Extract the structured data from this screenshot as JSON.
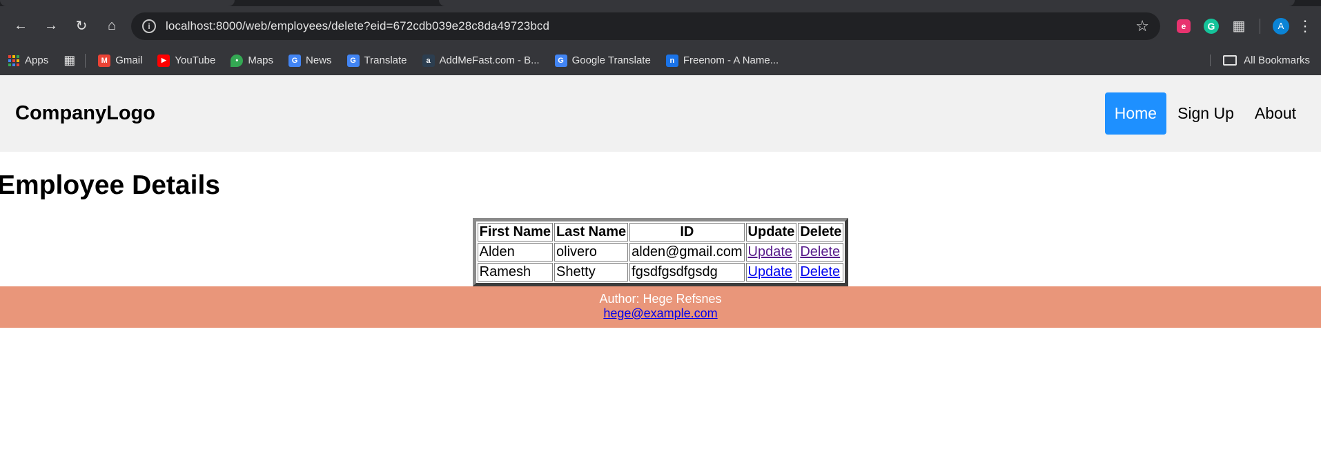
{
  "browser": {
    "url": "localhost:8000/web/employees/delete?eid=672cdb039e28c8da49723bcd",
    "avatar_letter": "A",
    "ext_e_letter": "e",
    "ext_g_letter": "G",
    "bookmarks": [
      {
        "label": "Apps",
        "icon": "apps-grid-icon"
      },
      {
        "label": "Gmail",
        "icon": "gmail-icon",
        "color": "#ea4335"
      },
      {
        "label": "YouTube",
        "icon": "youtube-icon",
        "color": "#ff0000"
      },
      {
        "label": "Maps",
        "icon": "maps-icon",
        "color": "#34a853"
      },
      {
        "label": "News",
        "icon": "news-icon",
        "color": "#4285f4"
      },
      {
        "label": "Translate",
        "icon": "translate-icon",
        "color": "#4285f4"
      },
      {
        "label": "AddMeFast.com - B...",
        "icon": "addmefast-icon",
        "color": "#2c3e50"
      },
      {
        "label": "Google Translate",
        "icon": "google-translate-icon",
        "color": "#4285f4"
      },
      {
        "label": "Freenom - A Name...",
        "icon": "freenom-icon",
        "color": "#1a73e8"
      }
    ],
    "all_bookmarks_label": "All Bookmarks"
  },
  "site": {
    "logo": "CompanyLogo",
    "nav": [
      {
        "label": "Home",
        "active": true
      },
      {
        "label": "Sign Up",
        "active": false
      },
      {
        "label": "About",
        "active": false
      }
    ],
    "heading": "Employee Details"
  },
  "table": {
    "headers": [
      "First Name",
      "Last Name",
      "ID",
      "Update",
      "Delete"
    ],
    "rows": [
      {
        "first": "Alden",
        "last": "olivero",
        "id": "alden@gmail.com",
        "update": "Update",
        "delete": "Delete"
      },
      {
        "first": "Ramesh",
        "last": "Shetty",
        "id": "fgsdfgsdfgsdg",
        "update": "Update",
        "delete": "Delete"
      }
    ]
  },
  "footer": {
    "author": "Author: Hege Refsnes",
    "email": "hege@example.com"
  },
  "colors": {
    "nav_active": "#1e90ff",
    "footer_bg": "#e9967a",
    "header_bg": "#f1f1f1"
  }
}
